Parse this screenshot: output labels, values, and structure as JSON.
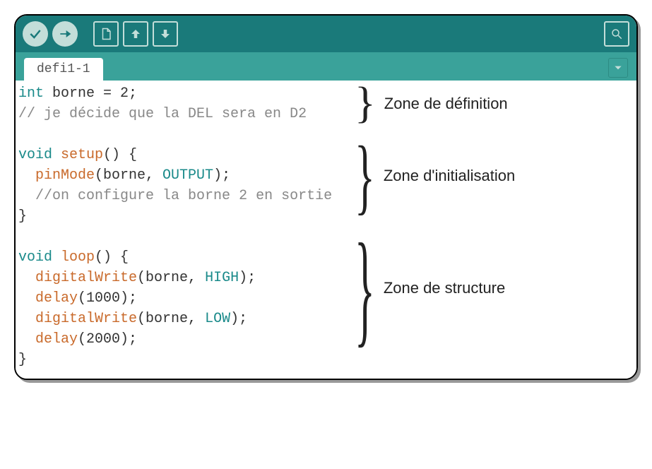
{
  "toolbar": {
    "verify_icon": "check-icon",
    "upload_icon": "arrow-right-icon",
    "new_icon": "file-icon",
    "open_icon": "arrow-up-icon",
    "save_icon": "arrow-down-icon",
    "serial_icon": "magnifier-icon"
  },
  "tab": {
    "label": "defi1-1",
    "menu_icon": "chevron-down-icon"
  },
  "code": {
    "lines": [
      {
        "tokens": [
          [
            "kw",
            "int"
          ],
          [
            "",
            " borne = 2;"
          ]
        ]
      },
      {
        "tokens": [
          [
            "comment",
            "// je décide que la DEL sera en D2"
          ]
        ]
      },
      {
        "tokens": [
          [
            "",
            ""
          ]
        ]
      },
      {
        "tokens": [
          [
            "kw",
            "void"
          ],
          [
            "",
            " "
          ],
          [
            "fn",
            "setup"
          ],
          [
            "",
            "() {"
          ]
        ]
      },
      {
        "tokens": [
          [
            "",
            "  "
          ],
          [
            "fn",
            "pinMode"
          ],
          [
            "",
            "(borne, "
          ],
          [
            "const",
            "OUTPUT"
          ],
          [
            "",
            ");"
          ]
        ]
      },
      {
        "tokens": [
          [
            "",
            "  "
          ],
          [
            "comment",
            "//on configure la borne 2 en sortie"
          ]
        ]
      },
      {
        "tokens": [
          [
            "",
            "}"
          ]
        ]
      },
      {
        "tokens": [
          [
            "",
            ""
          ]
        ]
      },
      {
        "tokens": [
          [
            "kw",
            "void"
          ],
          [
            "",
            " "
          ],
          [
            "fn",
            "loop"
          ],
          [
            "",
            "() {"
          ]
        ]
      },
      {
        "tokens": [
          [
            "",
            "  "
          ],
          [
            "fn",
            "digitalWrite"
          ],
          [
            "",
            "(borne, "
          ],
          [
            "const",
            "HIGH"
          ],
          [
            "",
            ");"
          ]
        ]
      },
      {
        "tokens": [
          [
            "",
            "  "
          ],
          [
            "fn",
            "delay"
          ],
          [
            "",
            "(1000);"
          ]
        ]
      },
      {
        "tokens": [
          [
            "",
            "  "
          ],
          [
            "fn",
            "digitalWrite"
          ],
          [
            "",
            "(borne, "
          ],
          [
            "const",
            "LOW"
          ],
          [
            "",
            ");"
          ]
        ]
      },
      {
        "tokens": [
          [
            "",
            "  "
          ],
          [
            "fn",
            "delay"
          ],
          [
            "",
            "(2000);"
          ]
        ]
      },
      {
        "tokens": [
          [
            "",
            "}"
          ]
        ]
      }
    ]
  },
  "annotations": [
    {
      "label": "Zone de définition",
      "sizeClass": "h1"
    },
    {
      "label": "Zone d'initialisation",
      "sizeClass": "h2"
    },
    {
      "label": "Zone de structure",
      "sizeClass": "h3"
    }
  ],
  "colors": {
    "toolbar_bg": "#1a7a7a",
    "tabbar_bg": "#3aa29a",
    "accent_light": "#c3ded9",
    "keyword": "#1a8a8a",
    "function": "#c96a2b",
    "comment": "#888888"
  }
}
